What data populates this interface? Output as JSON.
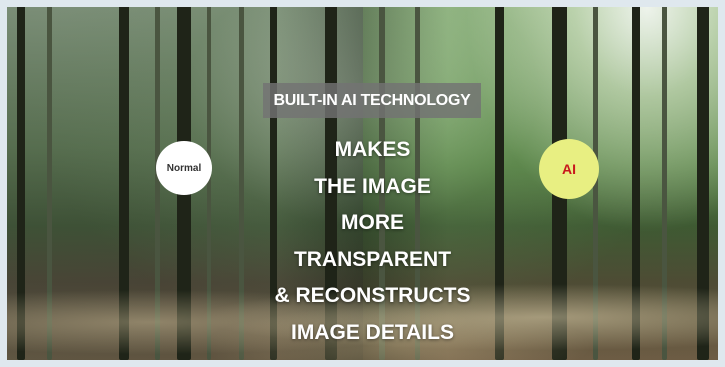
{
  "banner": {
    "headline": "BUILT-IN AI TECHNOLOGY",
    "lines": [
      "MAKES",
      "THE IMAGE",
      "MORE",
      "TRANSPARENT",
      "& RECONSTRUCTS",
      "IMAGE DETAILS"
    ]
  },
  "badges": {
    "normal": "Normal",
    "ai": "AI"
  },
  "colors": {
    "headline_bg": "#737373",
    "normal_badge_bg": "#ffffff",
    "ai_badge_bg": "#e8ef82",
    "ai_badge_text": "#c8171c"
  }
}
